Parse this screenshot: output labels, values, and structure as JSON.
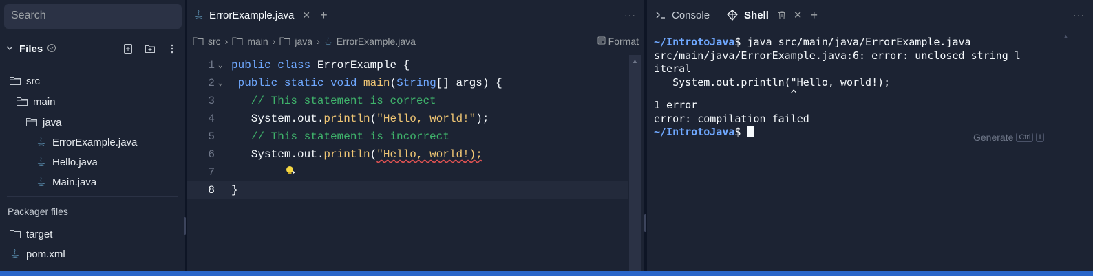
{
  "sidebar": {
    "search_placeholder": "Search",
    "files_title": "Files",
    "tree": [
      {
        "label": "src",
        "kind": "folder"
      },
      {
        "label": "main",
        "kind": "folder"
      },
      {
        "label": "java",
        "kind": "folder"
      },
      {
        "label": "ErrorExample.java",
        "kind": "java"
      },
      {
        "label": "Hello.java",
        "kind": "java"
      },
      {
        "label": "Main.java",
        "kind": "java"
      }
    ],
    "packager_title": "Packager files",
    "packager": [
      {
        "label": "target",
        "kind": "folder"
      },
      {
        "label": "pom.xml",
        "kind": "java"
      }
    ]
  },
  "editor": {
    "tab_label": "ErrorExample.java",
    "breadcrumb": [
      "src",
      "main",
      "java",
      "ErrorExample.java"
    ],
    "format_label": "Format",
    "line_numbers": [
      "1",
      "2",
      "3",
      "4",
      "5",
      "6",
      "7",
      "8"
    ],
    "lines": {
      "l1_kw": "public class",
      "l1_rest": " ErrorExample {",
      "l2_kw": " public static void",
      "l2_fn": " main",
      "l2_paren": "(",
      "l2_type": "String",
      "l2_rest": "[] args) {",
      "l3": "   // This statement is correct",
      "l4_a": "   System.out.",
      "l4_fn": "println",
      "l4_b": "(",
      "l4_str": "\"Hello, world!\"",
      "l4_c": ");",
      "l5": "   // This statement is incorrect",
      "l6_a": "   System.out.",
      "l6_fn": "println",
      "l6_b": "(",
      "l6_err": "\"Hello, world!);",
      "l8": "}"
    }
  },
  "shell": {
    "console_label": "Console",
    "shell_label": "Shell",
    "prompt": "~/IntrotoJava",
    "command": "$ java src/main/java/ErrorExample.java",
    "output": [
      "src/main/java/ErrorExample.java:6: error: unclosed string l",
      "iteral",
      "   System.out.println(\"Hello, world!);",
      "                      ^",
      "1 error",
      "error: compilation failed"
    ],
    "prompt2_suffix": "$ ",
    "generate_label": "Generate",
    "shortcut_key1": "Ctrl",
    "shortcut_key2": "I"
  },
  "colors": {
    "background": "#1c2333",
    "keyword": "#6fa8ff",
    "comment": "#3fb36b",
    "string": "#f0c674",
    "error_underline": "#e05252",
    "status_bar": "#2a66c9"
  }
}
